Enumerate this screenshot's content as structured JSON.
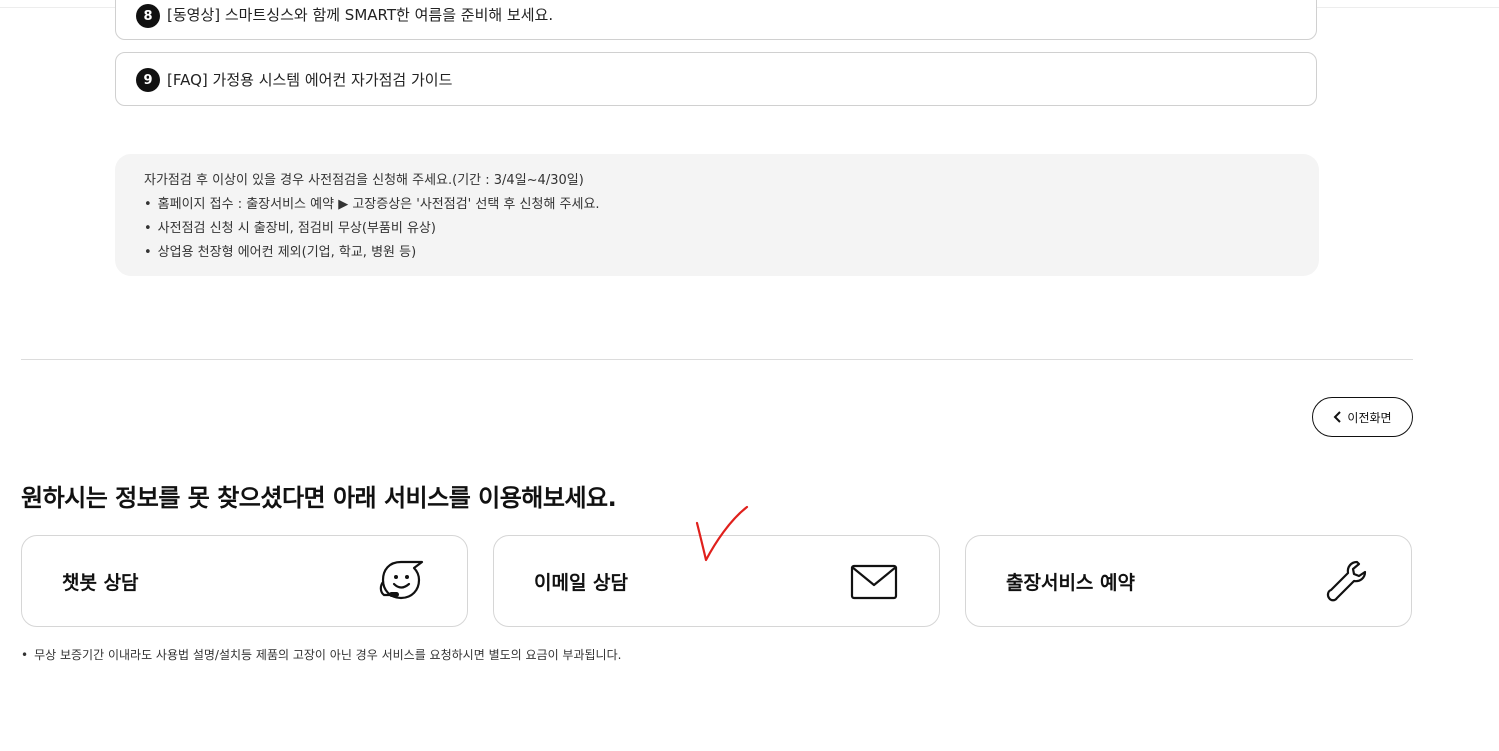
{
  "faq": {
    "items": [
      {
        "number": "8",
        "text": "[동영상] 스마트싱스와 함께 SMART한 여름을 준비해 보세요."
      },
      {
        "number": "9",
        "text": "[FAQ] 가정용 시스템 에어컨 자가점검 가이드"
      }
    ]
  },
  "notice": {
    "intro": "자가점검 후 이상이 있을 경우 사전점검을 신청해 주세요.(기간 : 3/4일~4/30일)",
    "bullets": [
      "홈페이지 접수 : 출장서비스 예약 ▶ 고장증상은 '사전점검' 선택 후 신청해 주세요.",
      "사전점검 신청 시 출장비, 점검비 무상(부품비 유상)",
      "상업용 천장형 에어컨 제외(기업, 학교, 병원 등)"
    ]
  },
  "navigation": {
    "back_label": "이전화면",
    "back_icon": "chevron-left-icon"
  },
  "help": {
    "heading": "원하시는 정보를 못 찾으셨다면 아래 서비스를 이용해보세요.",
    "cards": [
      {
        "label": "챗봇 상담",
        "icon": "chatbot-icon"
      },
      {
        "label": "이메일 상담",
        "icon": "mail-icon"
      },
      {
        "label": "출장서비스 예약",
        "icon": "wrench-icon"
      }
    ],
    "footnote": "무상 보증기간 이내라도 사용법 설명/설치등 제품의 고장이 아닌 경우 서비스를 요청하시면 별도의 요금이 부과됩니다."
  },
  "annotation": {
    "color": "#e0201c"
  }
}
